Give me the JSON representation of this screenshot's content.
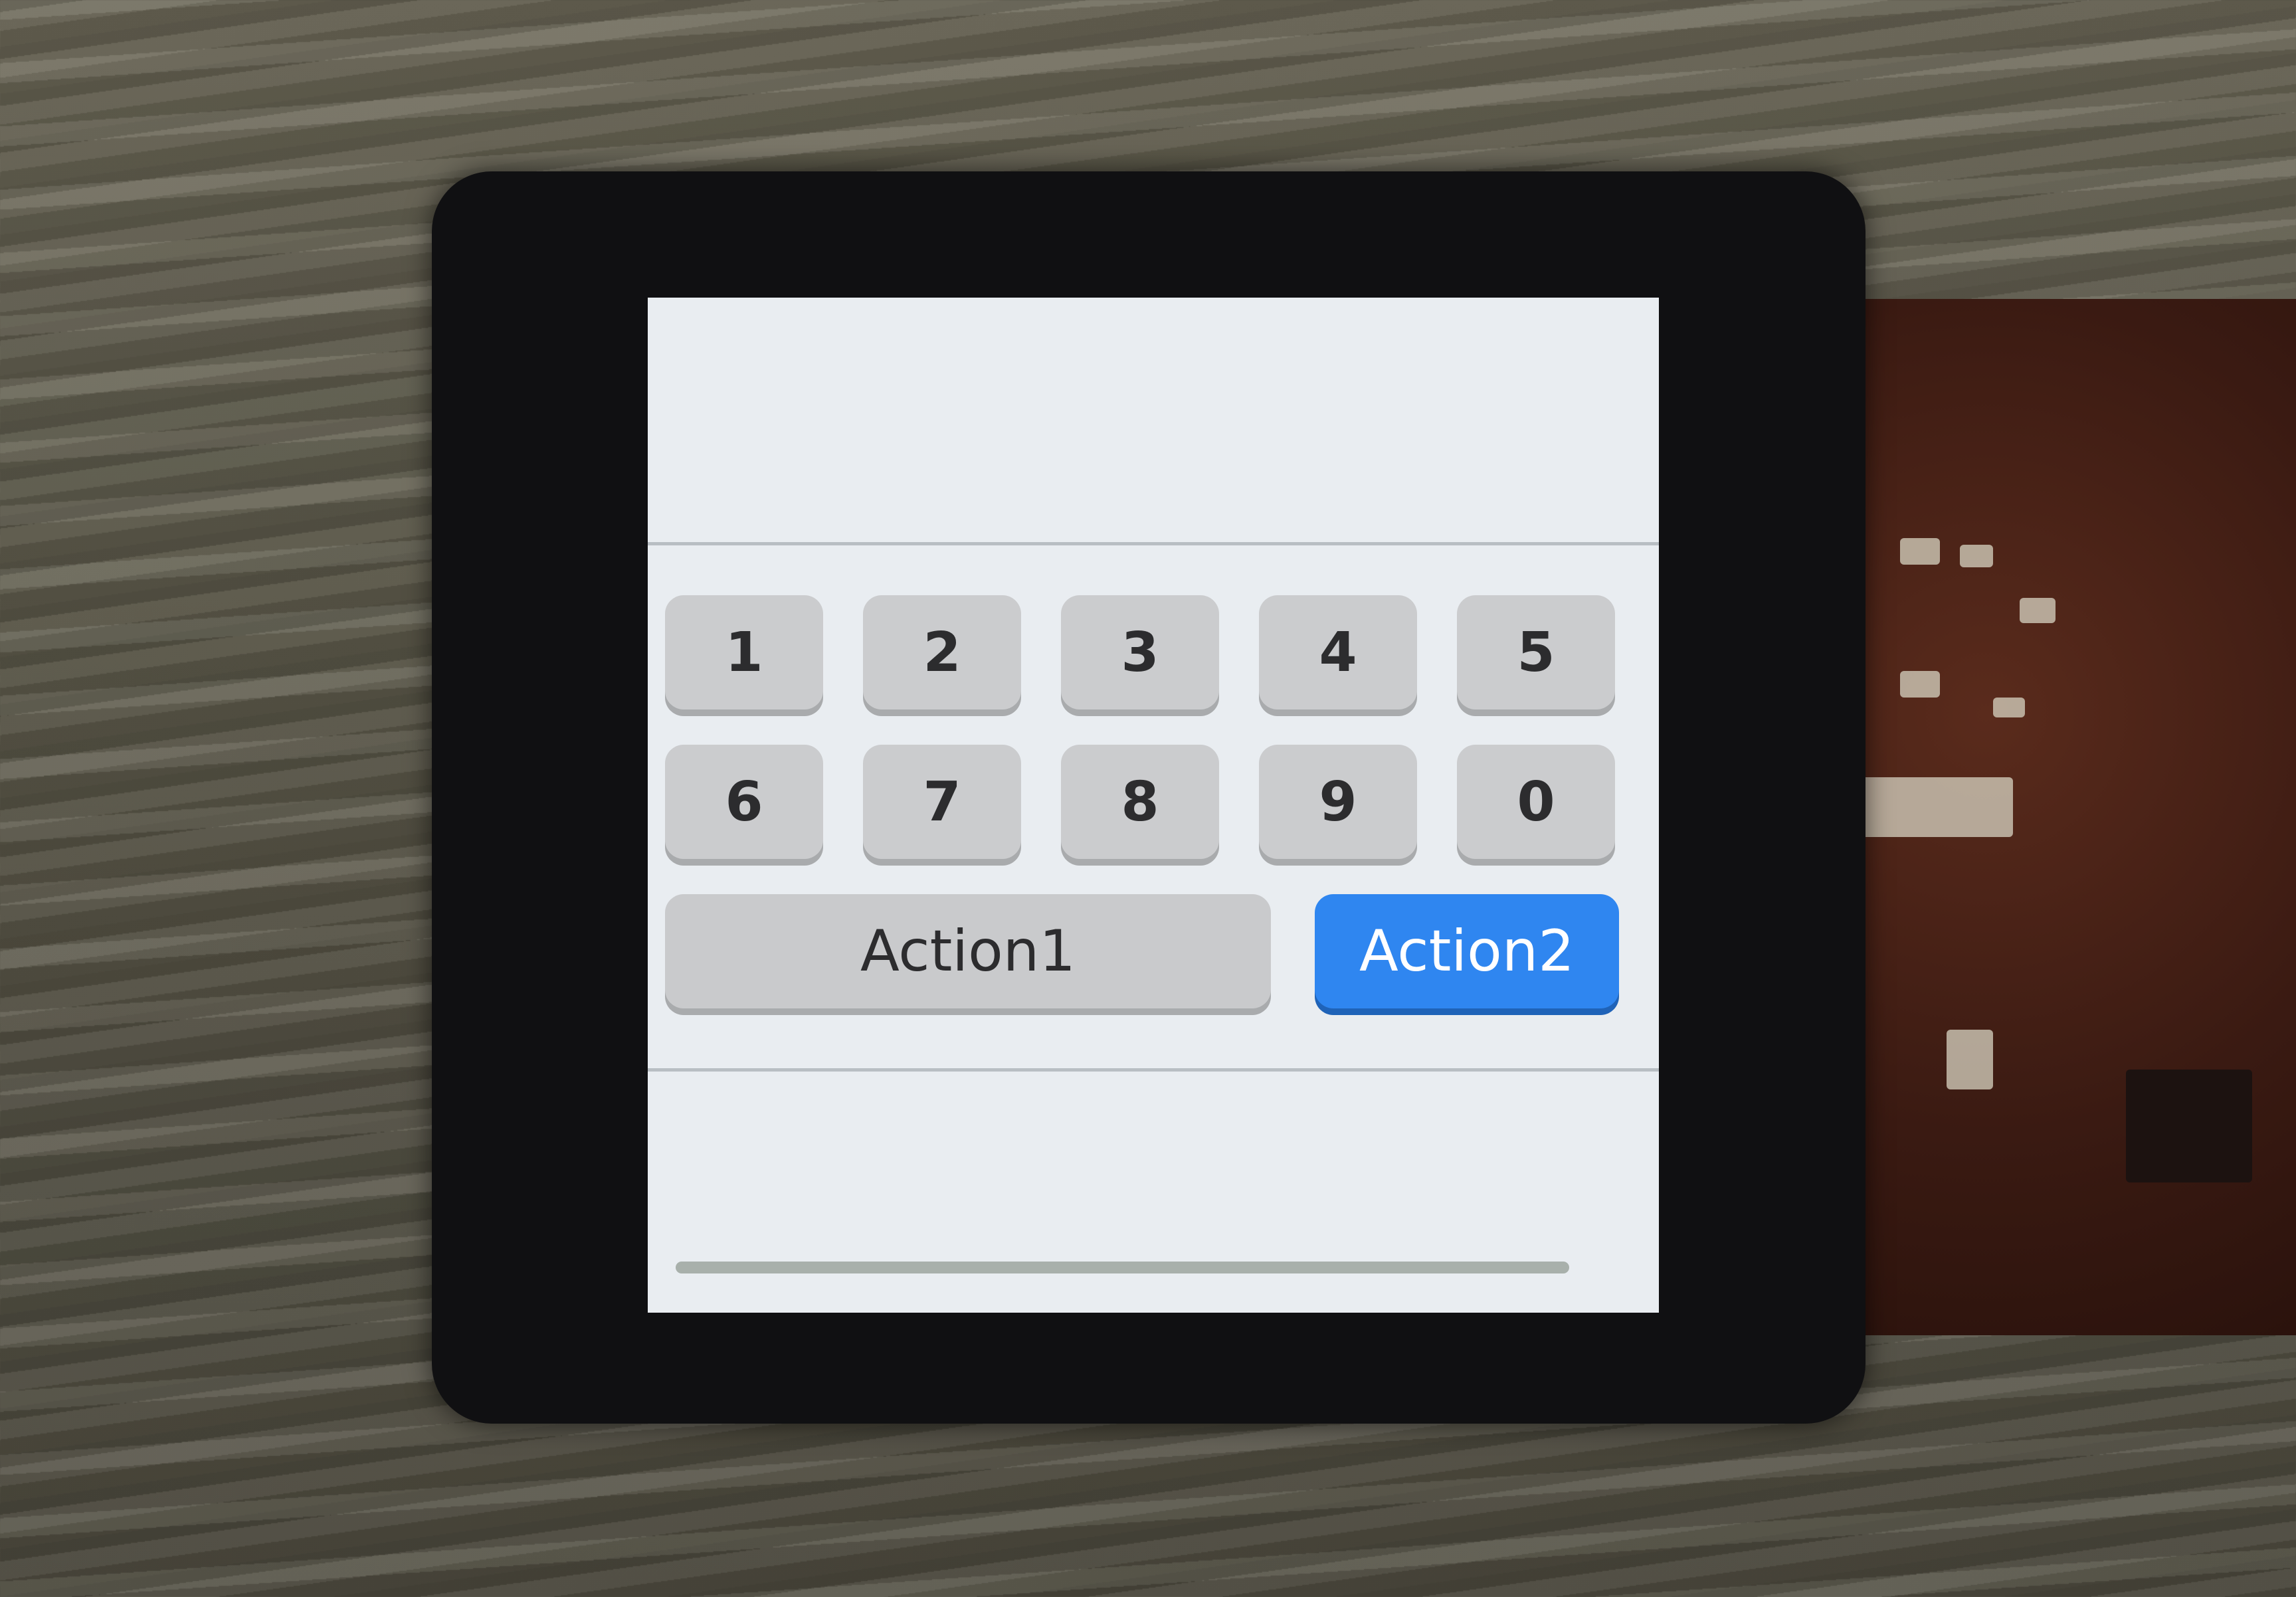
{
  "keypad": {
    "row1": [
      "1",
      "2",
      "3",
      "4",
      "5"
    ],
    "row2": [
      "6",
      "7",
      "8",
      "9",
      "0"
    ]
  },
  "actions": {
    "action1_label": "Action1",
    "action2_label": "Action2"
  },
  "colors": {
    "accent": "#2f86f0",
    "key_bg": "#cbccce",
    "screen_bg": "#e9edf1"
  }
}
